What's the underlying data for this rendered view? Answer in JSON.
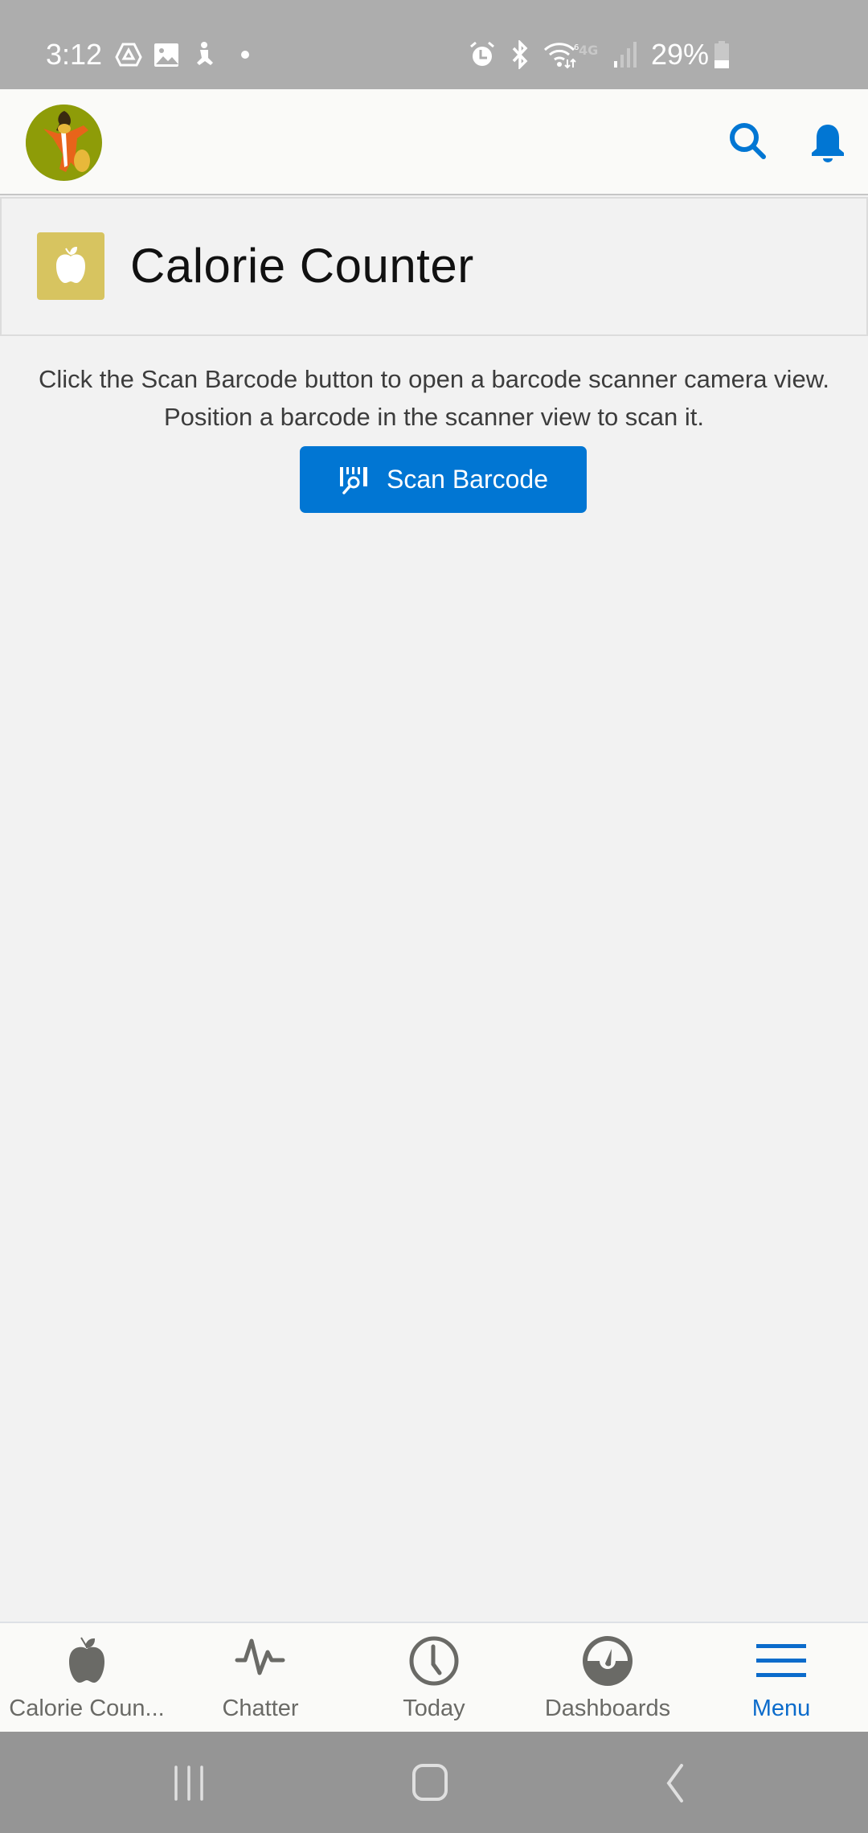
{
  "status_bar": {
    "time": "3:12",
    "left_icons": [
      "drive-icon",
      "gallery-icon",
      "fitness-icon",
      "dot-icon"
    ],
    "right_icons": [
      "alarm-icon",
      "bluetooth-icon",
      "wifi-icon",
      "4g-lte-icon",
      "signal-icon"
    ],
    "battery_percent": "29%",
    "battery_level": 0.29
  },
  "header": {
    "avatar_alt": "User avatar",
    "search_icon": "search-icon",
    "notifications_icon": "bell-icon",
    "accent_color": "#0176d3"
  },
  "title_card": {
    "icon": "apple-icon",
    "icon_color": "#d7c460",
    "title": "Calorie Counter"
  },
  "main": {
    "instructions": "Click the Scan Barcode button to open a barcode scanner camera view. Position a barcode in the scanner view to scan it.",
    "scan_button": {
      "label": "Scan Barcode",
      "icon": "barcode-scan-icon"
    }
  },
  "bottom_nav": {
    "items": [
      {
        "label": "Calorie Coun...",
        "icon": "apple-icon",
        "active": false
      },
      {
        "label": "Chatter",
        "icon": "pulse-icon",
        "active": false
      },
      {
        "label": "Today",
        "icon": "clock-icon",
        "active": false
      },
      {
        "label": "Dashboards",
        "icon": "gauge-icon",
        "active": false
      },
      {
        "label": "Menu",
        "icon": "hamburger-icon",
        "active": true
      }
    ],
    "active_color": "#0b6bcb",
    "inactive_color": "#6a6a66"
  },
  "system_nav": {
    "buttons": [
      "recent-apps",
      "home",
      "back"
    ]
  }
}
